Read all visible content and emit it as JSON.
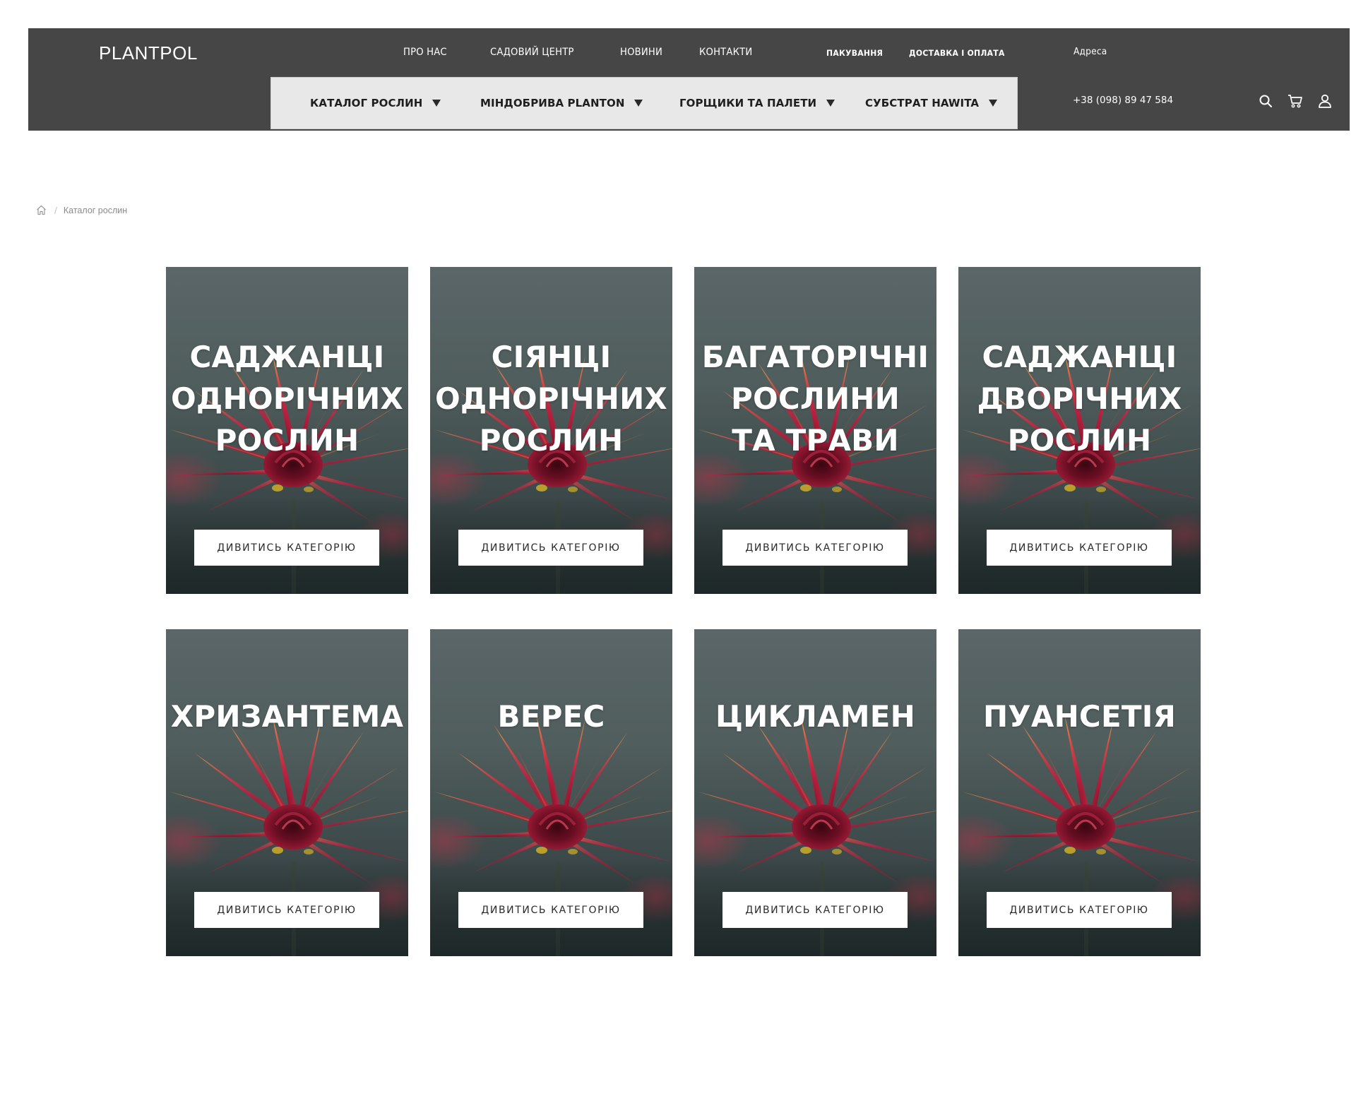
{
  "header": {
    "logo": "PLANTPOL",
    "nav": {
      "about": "ПРО НАС",
      "garden_center": "САДОВИЙ ЦЕНТР",
      "news": "НОВИНИ",
      "contacts": "КОНТАКТИ",
      "packaging": "ПАКУВАННЯ",
      "delivery": "ДОСТАВКА І ОПЛАТА",
      "address": "Адреса"
    },
    "phone": "+38 (098) 89 47 584",
    "catalog_menu": [
      {
        "label": "КАТАЛОГ РОСЛИН"
      },
      {
        "label": "МІНДОБРИВА PLANTON"
      },
      {
        "label": "ГОРЩИКИ ТА ПАЛЕТИ"
      },
      {
        "label": "СУБСТРАТ HAWITA"
      }
    ],
    "icons": [
      "search-icon",
      "cart-icon",
      "user-icon"
    ]
  },
  "breadcrumb": {
    "home_icon": "home-icon",
    "current": "Каталог рослин"
  },
  "categories": [
    {
      "title": "САДЖАНЦІ\nОДНОРІЧНИХ\nРОСЛИН",
      "button": "ДИВИТИСЬ КАТЕГОРІЮ"
    },
    {
      "title": "СІЯНЦІ\nОДНОРІЧНИХ\nРОСЛИН",
      "button": "ДИВИТИСЬ КАТЕГОРІЮ"
    },
    {
      "title": "БАГАТОРІЧНІ\nРОСЛИНИ\nТА ТРАВИ",
      "button": "ДИВИТИСЬ КАТЕГОРІЮ"
    },
    {
      "title": "САДЖАНЦІ\nДВОРІЧНИХ\nРОСЛИН",
      "button": "ДИВИТИСЬ КАТЕГОРІЮ"
    },
    {
      "title": "ХРИЗАНТЕМА",
      "button": "ДИВИТИСЬ КАТЕГОРІЮ"
    },
    {
      "title": "ВЕРЕС",
      "button": "ДИВИТИСЬ КАТЕГОРІЮ"
    },
    {
      "title": "ЦИКЛАМЕН",
      "button": "ДИВИТИСЬ КАТЕГОРІЮ"
    },
    {
      "title": "ПУАНСЕТІЯ",
      "button": "ДИВИТИСЬ КАТЕГОРІЮ"
    }
  ],
  "colors": {
    "header_bg": "#464646",
    "catalog_bar_bg": "#e8e8e8",
    "card_bg": "#52605f",
    "flower_red": "#b8203d",
    "flower_orange": "#e07a3a"
  }
}
